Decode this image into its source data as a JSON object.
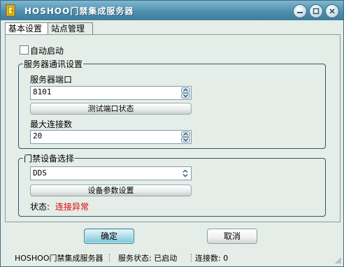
{
  "window": {
    "title": "HOSHOO门禁集成服务器"
  },
  "tabs": [
    {
      "label": "基本设置",
      "active": true
    },
    {
      "label": "站点管理",
      "active": false
    }
  ],
  "basic": {
    "auto_start_label": "自动启动",
    "auto_start_checked": false,
    "comm_group": {
      "title": "服务器通讯设置",
      "port_label": "服务器端口",
      "port_value": "8101",
      "test_port_button": "测试端口状态",
      "max_conn_label": "最大连接数",
      "max_conn_value": "20"
    },
    "device_group": {
      "title": "门禁设备选择",
      "device_selected": "DDS",
      "device_params_button": "设备参数设置",
      "status_label": "状态:",
      "status_value": "连接异常",
      "status_color": "#e20000"
    }
  },
  "buttons": {
    "ok": "确定",
    "cancel": "取消"
  },
  "statusbar": {
    "app_name": "HOSHOO门禁集成服务器",
    "service_status": "服务状态: 已启动",
    "connections": "连接数: 0"
  },
  "icons": {
    "app": "app-icon",
    "minimize": "minimize-icon",
    "maximize": "maximize-icon",
    "close": "close-icon",
    "spin_up": "spin-up-icon",
    "spin_down": "spin-down-icon",
    "combo_arrows": "updown-chevron-icon",
    "size_grip": "size-grip-icon"
  },
  "colors": {
    "titlebar": "#4f8fae",
    "ok_button": "#a9dbe8",
    "status_error": "#e20000"
  }
}
